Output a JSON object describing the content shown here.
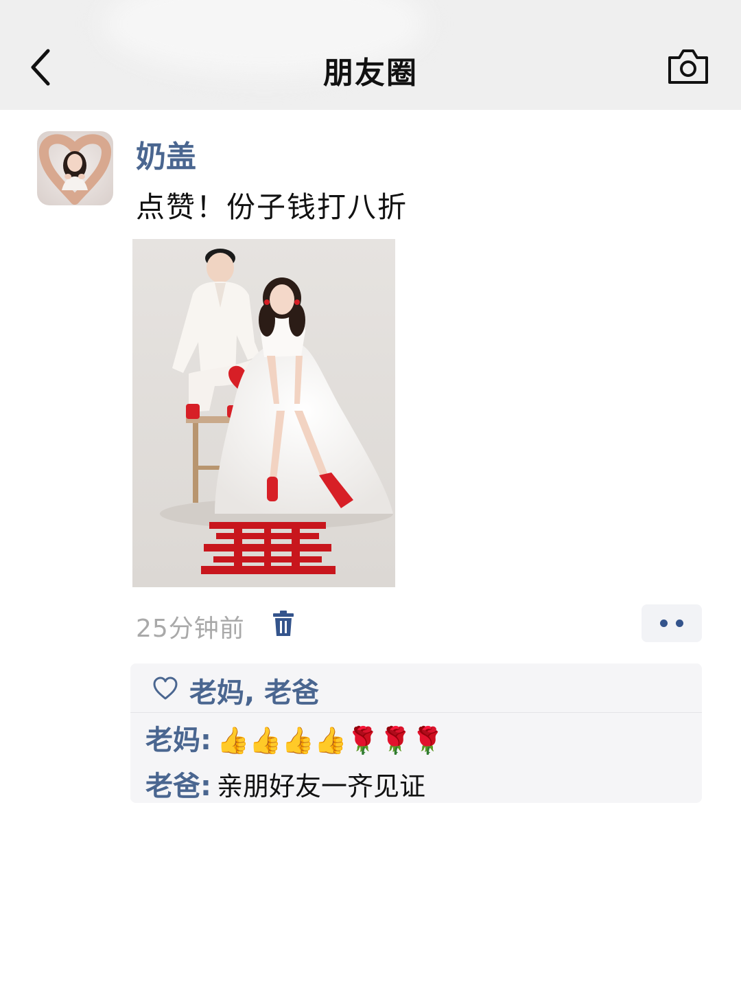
{
  "header": {
    "title": "朋友圈",
    "back_icon": "chevron-left-icon",
    "camera_icon": "camera-icon"
  },
  "post": {
    "author": "奶盖",
    "text": "点赞！份子钱打八折",
    "time": "25分钟前",
    "delete_icon": "trash-icon",
    "more_icon": "more-dots-icon"
  },
  "likes": {
    "icon": "heart-icon",
    "names": "老妈, 老爸"
  },
  "comments": [
    {
      "author": "老妈",
      "text": "👍👍👍👍🌹🌹🌹"
    },
    {
      "author": "老爸",
      "text": "亲朋好友一齐见证"
    }
  ],
  "colors": {
    "link_blue": "#4a6690",
    "top_bar_bg": "#efefef",
    "panel_bg": "#f5f5f7",
    "time_gray": "#a9a9a9",
    "accent_red": "#c8161d"
  }
}
